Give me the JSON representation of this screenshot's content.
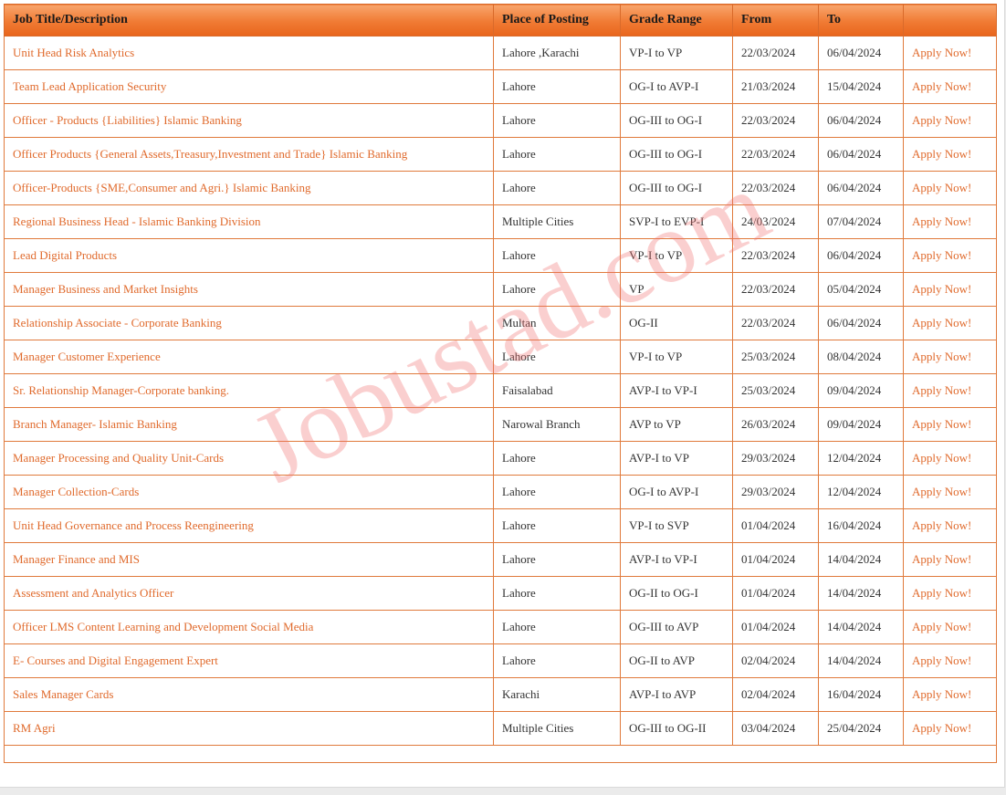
{
  "table": {
    "headers": {
      "title": "Job Title/Description",
      "place": "Place of Posting",
      "grade": "Grade Range",
      "from": "From",
      "to": "To",
      "action": ""
    },
    "rows": [
      {
        "title": "Unit Head Risk Analytics",
        "place": "Lahore ,Karachi",
        "grade": "VP-I to VP",
        "from": "22/03/2024",
        "to": "06/04/2024",
        "apply": "Apply Now!"
      },
      {
        "title": "Team Lead Application Security",
        "place": "Lahore",
        "grade": "OG-I to AVP-I",
        "from": "21/03/2024",
        "to": "15/04/2024",
        "apply": "Apply Now!"
      },
      {
        "title": "Officer - Products {Liabilities} Islamic Banking",
        "place": "Lahore",
        "grade": "OG-III to OG-I",
        "from": "22/03/2024",
        "to": "06/04/2024",
        "apply": "Apply Now!"
      },
      {
        "title": "Officer Products {General Assets,Treasury,Investment and Trade} Islamic Banking",
        "place": "Lahore",
        "grade": "OG-III to OG-I",
        "from": "22/03/2024",
        "to": "06/04/2024",
        "apply": "Apply Now!"
      },
      {
        "title": "Officer-Products {SME,Consumer and Agri.} Islamic Banking",
        "place": "Lahore",
        "grade": "OG-III to OG-I",
        "from": "22/03/2024",
        "to": "06/04/2024",
        "apply": "Apply Now!"
      },
      {
        "title": "Regional Business Head - Islamic Banking Division",
        "place": "Multiple Cities",
        "grade": "SVP-I to EVP-I",
        "from": "24/03/2024",
        "to": "07/04/2024",
        "apply": "Apply Now!"
      },
      {
        "title": "Lead Digital Products",
        "place": "Lahore",
        "grade": "VP-I to VP",
        "from": "22/03/2024",
        "to": "06/04/2024",
        "apply": "Apply Now!"
      },
      {
        "title": "Manager Business and Market Insights",
        "place": "Lahore",
        "grade": "VP",
        "from": "22/03/2024",
        "to": "05/04/2024",
        "apply": "Apply Now!"
      },
      {
        "title": "Relationship Associate - Corporate Banking",
        "place": "Multan",
        "grade": "OG-II",
        "from": "22/03/2024",
        "to": "06/04/2024",
        "apply": "Apply Now!"
      },
      {
        "title": "Manager Customer Experience",
        "place": "Lahore",
        "grade": "VP-I to VP",
        "from": "25/03/2024",
        "to": "08/04/2024",
        "apply": "Apply Now!"
      },
      {
        "title": "Sr. Relationship Manager-Corporate banking.",
        "place": "Faisalabad",
        "grade": "AVP-I to VP-I",
        "from": "25/03/2024",
        "to": "09/04/2024",
        "apply": "Apply Now!"
      },
      {
        "title": "Branch Manager- Islamic Banking",
        "place": "Narowal Branch",
        "grade": "AVP to VP",
        "from": "26/03/2024",
        "to": "09/04/2024",
        "apply": "Apply Now!"
      },
      {
        "title": "Manager Processing and Quality Unit-Cards",
        "place": "Lahore",
        "grade": "AVP-I to VP",
        "from": "29/03/2024",
        "to": "12/04/2024",
        "apply": "Apply Now!"
      },
      {
        "title": "Manager Collection-Cards",
        "place": "Lahore",
        "grade": "OG-I to AVP-I",
        "from": "29/03/2024",
        "to": "12/04/2024",
        "apply": "Apply Now!"
      },
      {
        "title": "Unit Head Governance and Process Reengineering",
        "place": "Lahore",
        "grade": "VP-I to SVP",
        "from": "01/04/2024",
        "to": "16/04/2024",
        "apply": "Apply Now!"
      },
      {
        "title": "Manager Finance and MIS",
        "place": "Lahore",
        "grade": "AVP-I to VP-I",
        "from": "01/04/2024",
        "to": "14/04/2024",
        "apply": "Apply Now!"
      },
      {
        "title": "Assessment and Analytics Officer",
        "place": "Lahore",
        "grade": "OG-II to OG-I",
        "from": "01/04/2024",
        "to": "14/04/2024",
        "apply": "Apply Now!"
      },
      {
        "title": "Officer LMS Content Learning and Development Social Media",
        "place": "Lahore",
        "grade": "OG-III to AVP",
        "from": "01/04/2024",
        "to": "14/04/2024",
        "apply": "Apply Now!"
      },
      {
        "title": "E- Courses and Digital Engagement Expert",
        "place": "Lahore",
        "grade": "OG-II to AVP",
        "from": "02/04/2024",
        "to": "14/04/2024",
        "apply": "Apply Now!"
      },
      {
        "title": "Sales Manager Cards",
        "place": "Karachi",
        "grade": "AVP-I to AVP",
        "from": "02/04/2024",
        "to": "16/04/2024",
        "apply": "Apply Now!"
      },
      {
        "title": "RM Agri",
        "place": "Multiple Cities",
        "grade": "OG-III to OG-II",
        "from": "03/04/2024",
        "to": "25/04/2024",
        "apply": "Apply Now!"
      }
    ]
  },
  "watermark": {
    "text": "Jobustad.com"
  },
  "colors": {
    "accent": "#e06a2c",
    "header_top": "#f8a56c",
    "header_bottom": "#e8651c",
    "border": "#e07a3c"
  }
}
